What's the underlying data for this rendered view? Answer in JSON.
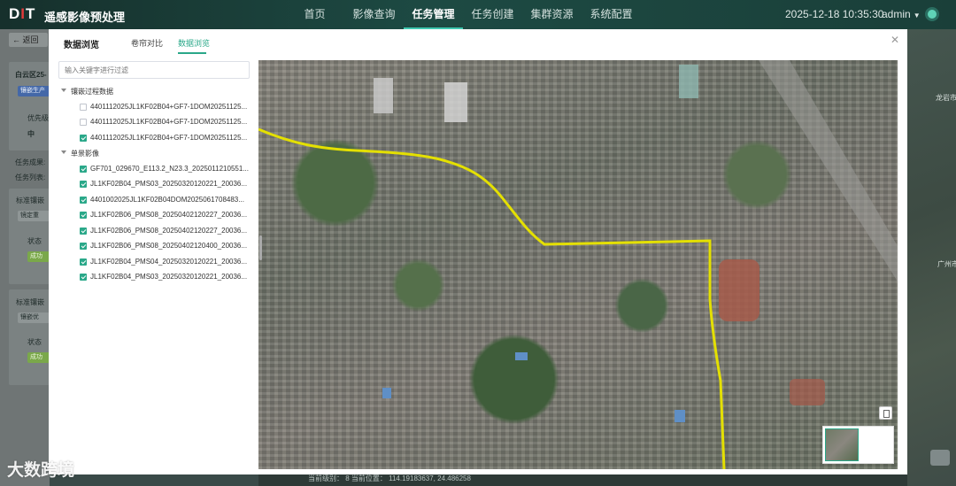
{
  "app": {
    "logo": "DIT",
    "title": "遥感影像预处理",
    "nav": [
      "首页",
      "影像查询",
      "任务管理",
      "任务创建",
      "集群资源",
      "系统配置"
    ],
    "active_nav": "任务管理",
    "datetime": "2025-12-18 10:35:30",
    "user": "admin"
  },
  "background_page": {
    "back_label": "返回",
    "card1_title": "白云区25-",
    "card1_chip": "镶嵌生产",
    "priority_label": "优先级",
    "priority_value": "中",
    "result_label": "任务成果:",
    "list_label": "任务列表:",
    "section1_title": "标准镶嵌",
    "section1_chip": "镜定重",
    "state_label1": "状态",
    "state_value1": "成功",
    "section2_title": "标准镶嵌",
    "section2_chip": "镶嵌优",
    "state_label2": "状态",
    "state_value2": "成功",
    "status_bar": "当前级别：  8   当前位置：  114.19183637,  24.486258"
  },
  "modal": {
    "title": "数据浏览",
    "tabs": [
      "卷帘对比",
      "数据浏览"
    ],
    "active_tab": "数据浏览",
    "close_icon": "close-icon",
    "filter_placeholder": "输入关键字进行过滤",
    "tree": {
      "group1": {
        "label": "镶嵌过程数据",
        "items": [
          {
            "label": "4401112025JL1KF02B04+GF7-1DOM20251125...",
            "checked": false
          },
          {
            "label": "4401112025JL1KF02B04+GF7-1DOM20251125...",
            "checked": false
          },
          {
            "label": "4401112025JL1KF02B04+GF7-1DOM20251125...",
            "checked": true
          }
        ]
      },
      "group2": {
        "label": "单景影像",
        "items": [
          {
            "label": "GF701_029670_E113.2_N23.3_2025011210551...",
            "checked": true
          },
          {
            "label": "JL1KF02B04_PMS03_20250320120221_20036...",
            "checked": true
          },
          {
            "label": "4401002025JL1KF02B04DOM2025061708483...",
            "checked": true
          },
          {
            "label": "JL1KF02B06_PMS08_20250402120227_20036...",
            "checked": true
          },
          {
            "label": "JL1KF02B06_PMS08_20250402120227_20036...",
            "checked": true
          },
          {
            "label": "JL1KF02B06_PMS08_20250402120400_20036...",
            "checked": true
          },
          {
            "label": "JL1KF02B04_PMS04_20250320120221_20036...",
            "checked": true
          },
          {
            "label": "JL1KF02B04_PMS03_20250320120221_20036...",
            "checked": true
          }
        ]
      }
    }
  },
  "map_labels": {
    "right_1": "龙岩市",
    "right_2": "广州市"
  },
  "colors": {
    "accent": "#2aa889",
    "boundary_line": "#e4e000",
    "topbar": "#1d4a43"
  },
  "watermark": "大数跨境"
}
